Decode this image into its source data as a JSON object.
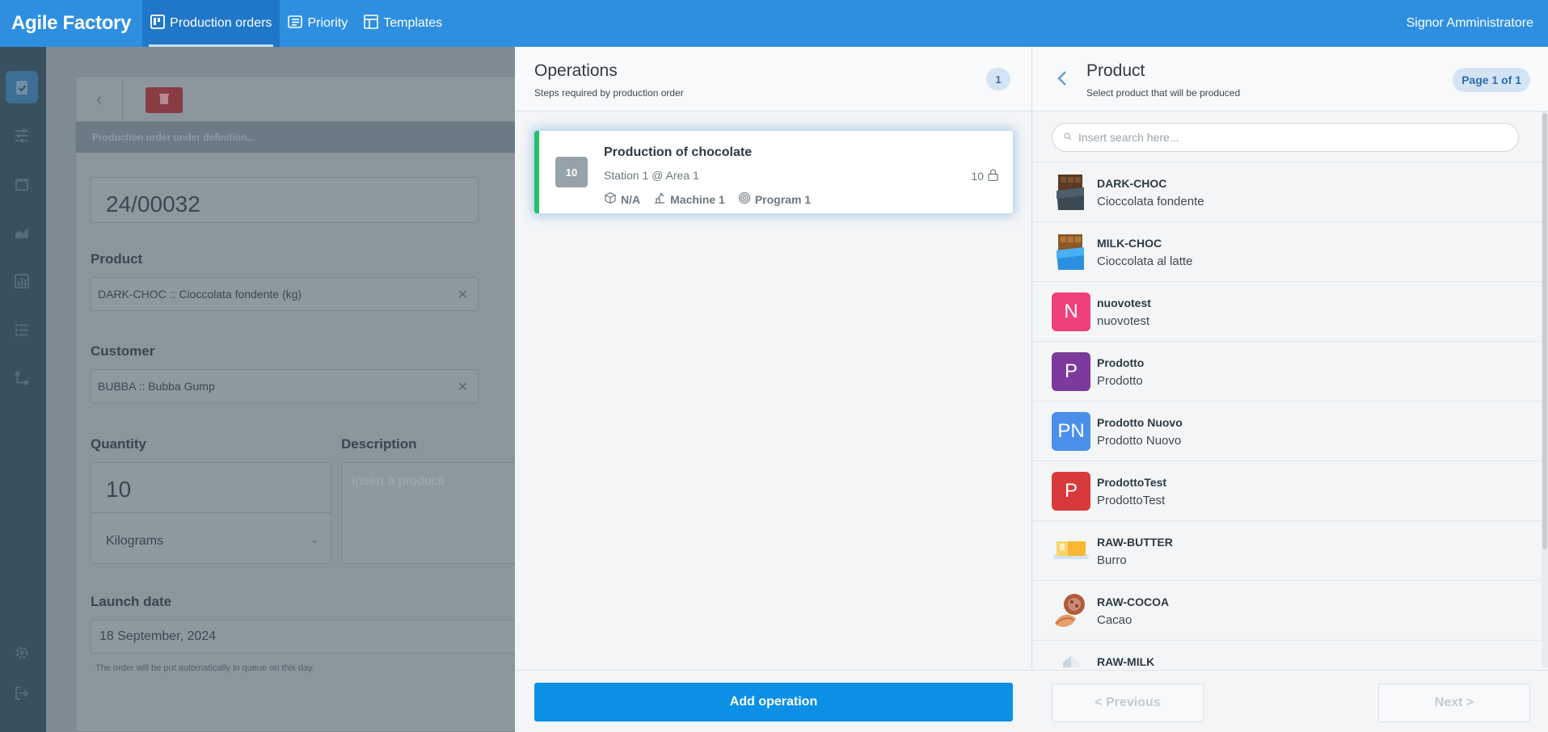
{
  "app": {
    "brand": "Agile Factory",
    "nav": [
      {
        "label": "Production orders",
        "icon": "kanban-icon",
        "active": true
      },
      {
        "label": "Priority",
        "icon": "priority-list-icon",
        "active": false
      },
      {
        "label": "Templates",
        "icon": "template-icon",
        "active": false
      }
    ],
    "user": "Signor Amministratore",
    "accent": "#2e8fe0"
  },
  "rail": {
    "icons": [
      "clipboard-check-icon",
      "sliders-icon",
      "calendar-icon",
      "area-chart-icon",
      "bar-chart-icon",
      "list-icon",
      "flow-icon",
      "gear-icon",
      "logout-icon"
    ]
  },
  "form": {
    "status": "Production order under definition...",
    "order_number": "24/00032",
    "product_label": "Product",
    "product_value": "DARK-CHOC :: Cioccolata fondente (kg)",
    "customer_label": "Customer",
    "customer_value": "BUBBA :: Bubba Gump",
    "quantity_label": "Quantity",
    "quantity_value": "10",
    "unit_value": "Kilograms",
    "description_label": "Description",
    "description_placeholder": "Insert a producti",
    "launch_label": "Launch date",
    "launch_value": "18 September, 2024",
    "launch_hint": "The order will be put automatically in queue on this day."
  },
  "operations": {
    "title": "Operations",
    "subtitle": "Steps required by production order",
    "count": "1",
    "items": [
      {
        "seq": "10",
        "name": "Production of chocolate",
        "station": "Station 1 @ Area 1",
        "package": "N/A",
        "machine": "Machine 1",
        "program": "Program 1",
        "quantity": "10"
      }
    ],
    "add_label": "Add operation",
    "accent_green": "#1ec467"
  },
  "product": {
    "title": "Product",
    "subtitle": "Select product that will be produced",
    "page": "Page 1 of 1",
    "search_placeholder": "Insert search here...",
    "items": [
      {
        "code": "DARK-CHOC",
        "desc": "Cioccolata fondente",
        "thumb": "dark-chocolate-icon"
      },
      {
        "code": "MILK-CHOC",
        "desc": "Cioccolata al latte",
        "thumb": "milk-chocolate-icon"
      },
      {
        "code": "nuovotest",
        "desc": "nuovotest",
        "initials": "N",
        "color": "#f0407a"
      },
      {
        "code": "Prodotto",
        "desc": "Prodotto",
        "initials": "P",
        "color": "#7b3a9c"
      },
      {
        "code": "Prodotto Nuovo",
        "desc": "Prodotto Nuovo",
        "initials": "PN",
        "color": "#4a8fea"
      },
      {
        "code": "ProdottoTest",
        "desc": "ProdottoTest",
        "initials": "P",
        "color": "#d8393a"
      },
      {
        "code": "RAW-BUTTER",
        "desc": "Burro",
        "thumb": "butter-icon"
      },
      {
        "code": "RAW-COCOA",
        "desc": "Cacao",
        "thumb": "cocoa-icon"
      },
      {
        "code": "RAW-MILK",
        "desc": "",
        "thumb": "milk-icon"
      }
    ],
    "prev_label": "< Previous",
    "next_label": "Next >"
  }
}
